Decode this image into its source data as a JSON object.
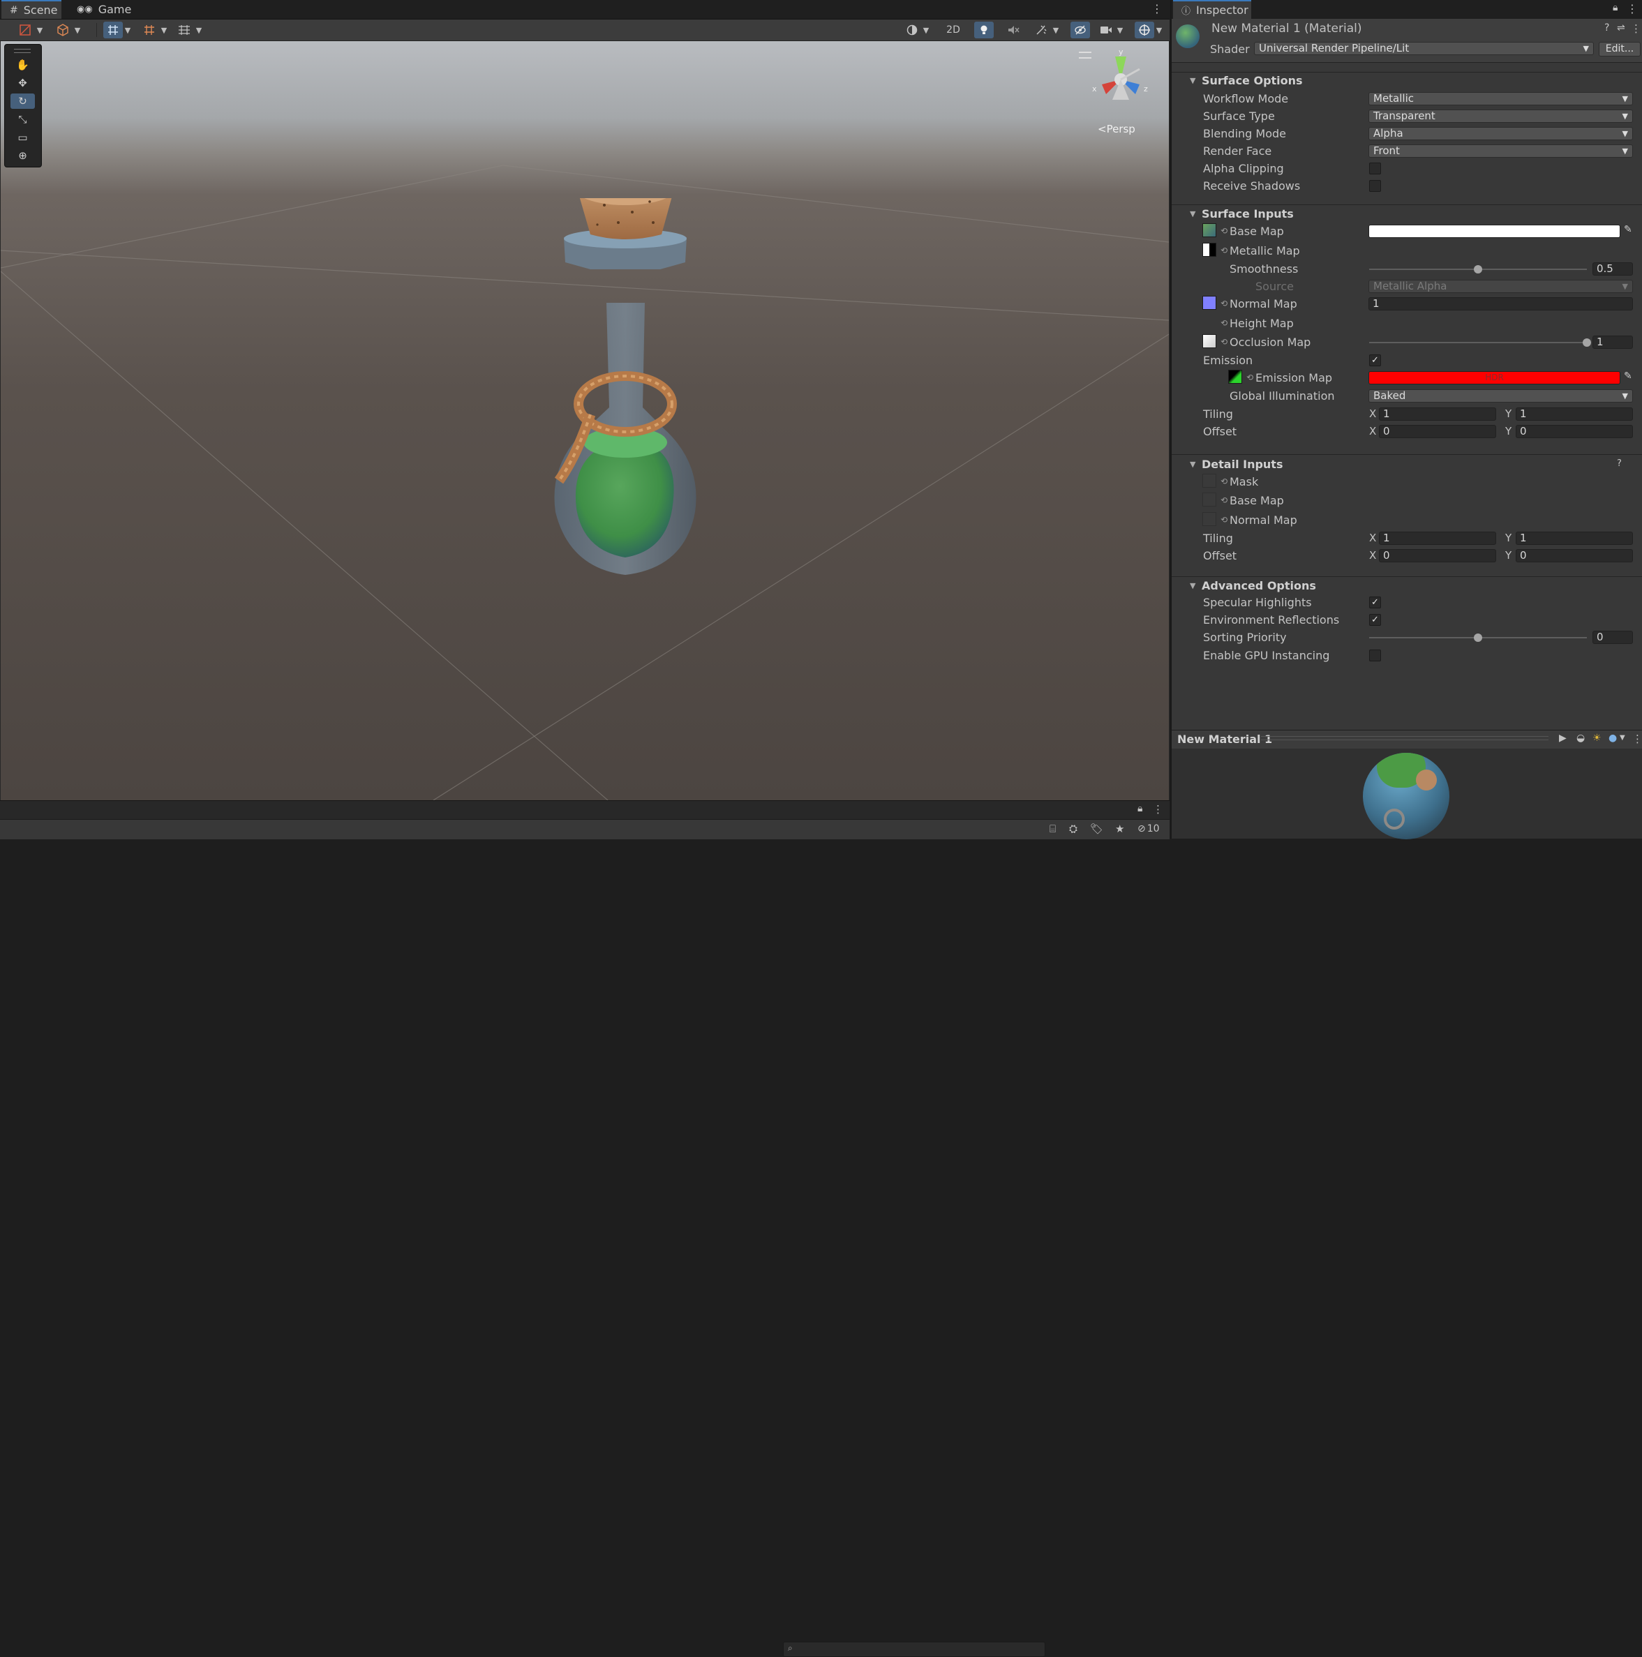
{
  "scene": {
    "tabs": [
      {
        "label": "Scene",
        "icon": "hashtag-icon"
      },
      {
        "label": "Game",
        "icon": "gamepad-icon"
      }
    ],
    "toolbar": {
      "mode_2d": "2D"
    },
    "gizmo_label": "<Persp",
    "gizmo_axes": {
      "x": "x",
      "y": "y",
      "z": "z"
    },
    "status_count": "10"
  },
  "inspector": {
    "tab_label": "Inspector",
    "material_title": "New Material 1 (Material)",
    "shader_label": "Shader",
    "shader_value": "Universal Render Pipeline/Lit",
    "edit_button": "Edit...",
    "surface_options": {
      "title": "Surface Options",
      "workflow_mode": {
        "label": "Workflow Mode",
        "value": "Metallic"
      },
      "surface_type": {
        "label": "Surface Type",
        "value": "Transparent"
      },
      "blending_mode": {
        "label": "Blending Mode",
        "value": "Alpha"
      },
      "render_face": {
        "label": "Render Face",
        "value": "Front"
      },
      "alpha_clipping": {
        "label": "Alpha Clipping",
        "checked": false
      },
      "receive_shadows": {
        "label": "Receive Shadows",
        "checked": false
      }
    },
    "surface_inputs": {
      "title": "Surface Inputs",
      "base_map": {
        "label": "Base Map",
        "color": "#ffffff"
      },
      "metallic_map": {
        "label": "Metallic Map"
      },
      "smoothness": {
        "label": "Smoothness",
        "value": "0.5",
        "level": 0.5
      },
      "source": {
        "label": "Source",
        "value": "Metallic Alpha"
      },
      "normal_map": {
        "label": "Normal Map",
        "value": "1"
      },
      "height_map": {
        "label": "Height Map"
      },
      "occlusion_map": {
        "label": "Occlusion Map",
        "value": "1",
        "level": 1.0
      },
      "emission": {
        "label": "Emission",
        "checked": true
      },
      "emission_map": {
        "label": "Emission Map",
        "color": "#ff0000",
        "hdr": "HDR"
      },
      "global_illumination": {
        "label": "Global Illumination",
        "value": "Baked"
      },
      "tiling": {
        "label": "Tiling",
        "x": "1",
        "y": "1"
      },
      "offset": {
        "label": "Offset",
        "x": "0",
        "y": "0"
      }
    },
    "detail_inputs": {
      "title": "Detail Inputs",
      "mask": {
        "label": "Mask"
      },
      "base_map": {
        "label": "Base Map"
      },
      "normal_map": {
        "label": "Normal Map"
      },
      "tiling": {
        "label": "Tiling",
        "x": "1",
        "y": "1"
      },
      "offset": {
        "label": "Offset",
        "x": "0",
        "y": "0"
      }
    },
    "advanced_options": {
      "title": "Advanced Options",
      "specular_highlights": {
        "label": "Specular Highlights",
        "checked": true
      },
      "environment_reflections": {
        "label": "Environment Reflections",
        "checked": true
      },
      "sorting_priority": {
        "label": "Sorting Priority",
        "value": "0",
        "level": 0.5
      },
      "gpu_instancing": {
        "label": "Enable GPU Instancing",
        "checked": false
      }
    },
    "xy_labels": {
      "x": "X",
      "y": "Y"
    },
    "preview_title": "New Material 1"
  },
  "colors": {
    "accent": "#3a79bb",
    "emission": "#ff0000",
    "potion_liquid": "#3f8f47",
    "cork": "#b98055"
  }
}
